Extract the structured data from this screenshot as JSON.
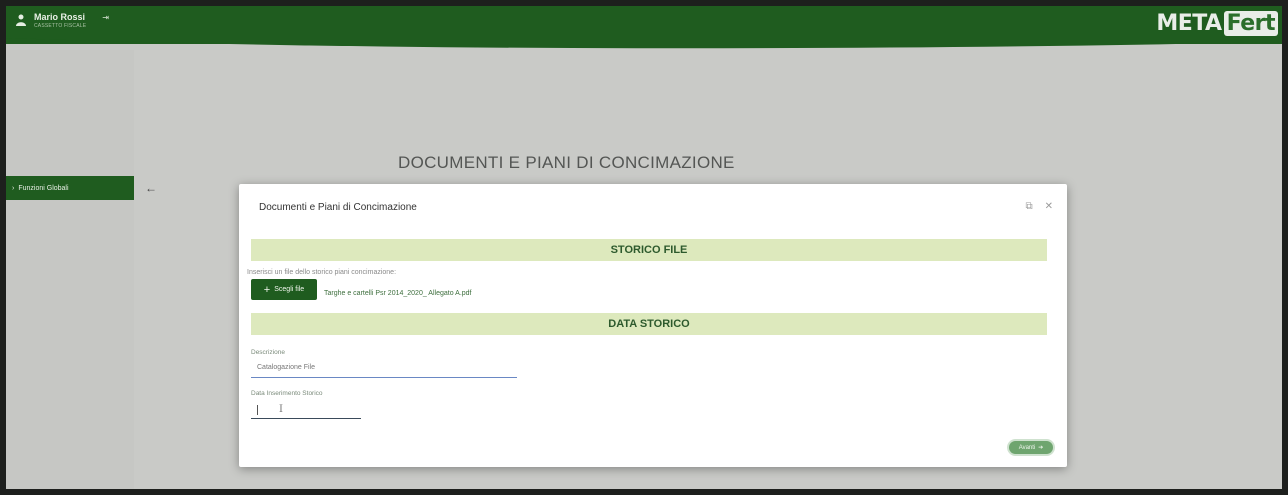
{
  "header": {
    "user_name": "Mario Rossi",
    "user_role": "CASSETTO FISCALE",
    "logout_icon": "logout-icon",
    "logo_part1": "META",
    "logo_part2": "Fert"
  },
  "sidebar": {
    "collapse_icon": "arrow-left-icon",
    "items": [
      {
        "label": "Funzioni Globali",
        "icon": "chevron-right-icon"
      }
    ]
  },
  "page": {
    "title": "DOCUMENTI E PIANI DI CONCIMAZIONE"
  },
  "modal": {
    "title": "Documenti e Piani di Concimazione",
    "maximize_icon": "maximize-icon",
    "close_icon": "close-icon",
    "section_file": "STORICO FILE",
    "hint": "Inserisci un file dello storico piani concimazione:",
    "choose_label": "Scegli file",
    "file_name": "Targhe e cartelli Psr 2014_2020_ Allegato A.pdf",
    "section_date": "DATA STORICO",
    "description_label": "Descrizione",
    "description_value": "Catalogazione File",
    "date_label": "Data Inserimento Storico",
    "next_label": "Avanti"
  },
  "colors": {
    "brand_green": "#1f5c1f",
    "section_bg": "#dde9bd"
  }
}
